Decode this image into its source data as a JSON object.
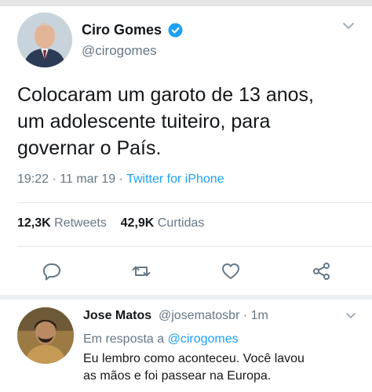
{
  "tweet": {
    "author_name": "Ciro Gomes",
    "author_handle": "@cirogomes",
    "text": "Colocaram um garoto de 13 anos,\num adolescente tuiteiro, para\ngovernar o País.",
    "time": "19:22",
    "date": "11 mar 19",
    "client": "Twitter for iPhone",
    "retweets_count": "12,3K",
    "retweets_label": "Retweets",
    "likes_count": "42,9K",
    "likes_label": "Curtidas"
  },
  "reply": {
    "author_name": "Jose Matos",
    "author_handle": "@josematosbr",
    "age": "1m",
    "in_reply_to_label": "Em resposta a",
    "in_reply_to_handle": "@cirogomes",
    "text": "Eu lembro como aconteceu. Você lavou\nas mãos e foi passear na Europa."
  },
  "colors": {
    "accent": "#1da1f2",
    "muted": "#657786",
    "text": "#14171a"
  },
  "icons": [
    "verified-badge-icon",
    "chevron-down-icon",
    "reply-icon",
    "retweet-icon",
    "like-icon",
    "share-icon"
  ]
}
